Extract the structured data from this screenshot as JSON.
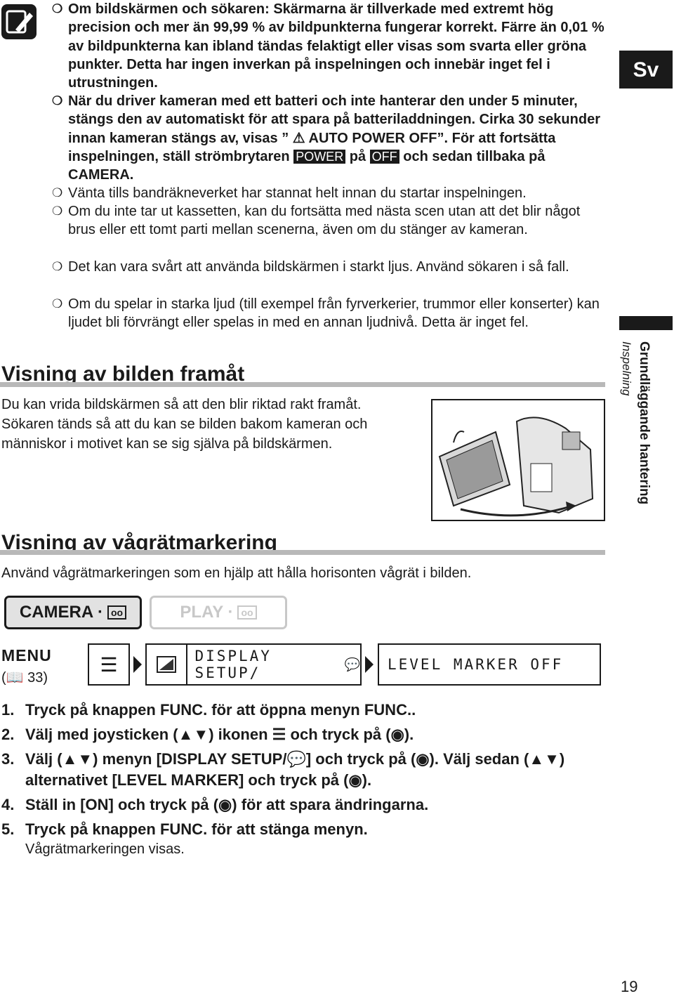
{
  "bullets": [
    {
      "bold": true,
      "text": "Om bildskärmen och sökaren: Skärmarna är tillverkade med extremt hög precision och mer än 99,99 % av bildpunkterna fungerar korrekt. Färre än 0,01 % av bildpunkterna kan ibland tändas felaktigt eller visas som svarta eller gröna punkter. Detta har ingen inverkan på inspelningen och innebär inget fel i utrustningen."
    },
    {
      "bold": true,
      "text_a": "När du driver kameran med ett batteri och inte hanterar den under 5 minuter, stängs den av automatiskt för att spara på batteriladdningen. Cirka 30 sekunder innan kameran stängs av, visas ”",
      "warning_text": "AUTO POWER OFF",
      "text_b": "”. För att fortsätta inspelningen, ställ strömbrytaren",
      "power_label": "POWER",
      "text_c": "på",
      "off_label": "OFF",
      "text_d": "och sedan tillbaka på CAMERA."
    },
    {
      "bold": false,
      "text": "Vänta tills bandräkneverket har stannat helt innan du startar inspelningen."
    },
    {
      "bold": false,
      "text": "Om du inte tar ut kassetten, kan du fortsätta med nästa scen utan att det blir något brus eller ett tomt parti mellan scenerna, även om du stänger av kameran."
    },
    {
      "bold": false,
      "text": "Det kan vara svårt att använda bildskärmen i starkt ljus. Använd sökaren i så fall."
    },
    {
      "bold": false,
      "text": "Om du spelar in starka ljud (till exempel från fyrverkerier, trummor eller konserter) kan ljudet bli förvrängt eller spelas in med en annan ljudnivå. Detta är inget fel."
    }
  ],
  "bullet_marker": "❍",
  "side": {
    "lang": "Sv",
    "chapter": "Grundläggande hantering",
    "section": "Inspelning"
  },
  "section1": {
    "title": "Visning av bilden framåt",
    "body": "Du kan vrida bildskärmen så att den blir riktad rakt framåt. Sökaren tänds så att du kan se bilden bakom kameran och människor i motivet kan se sig själva på bildskärmen."
  },
  "section2": {
    "title": "Visning av vågrätmarkering",
    "body": "Använd vågrätmarkeringen som en hjälp att hålla horisonten vågrät i bilden."
  },
  "modes": {
    "camera": "CAMERA ·",
    "play": "PLAY ·"
  },
  "menu": {
    "label": "MENU",
    "ref_page": "33",
    "submenu": "DISPLAY SETUP/",
    "setting": "LEVEL MARKER OFF"
  },
  "steps": [
    {
      "n": "1.",
      "text": "Tryck på knappen FUNC. för att öppna menyn FUNC.."
    },
    {
      "n": "2.",
      "a": "Välj med joysticken (",
      "b": ") ikonen",
      "c": "och tryck på (",
      "d": ")."
    },
    {
      "n": "3.",
      "a": "Välj (",
      "b": ") menyn [DISPLAY SETUP/",
      "c": "] och tryck på (",
      "d": "). Välj sedan (",
      "e": ") alternativet [LEVEL MARKER] och tryck på (",
      "f": ")."
    },
    {
      "n": "4.",
      "a": "Ställ in [ON] och tryck på (",
      "b": ") för att spara ändringarna."
    },
    {
      "n": "5.",
      "text": "Tryck på knappen FUNC. för att stänga menyn."
    }
  ],
  "result": "Vågrätmarkeringen visas.",
  "page_number": "19"
}
